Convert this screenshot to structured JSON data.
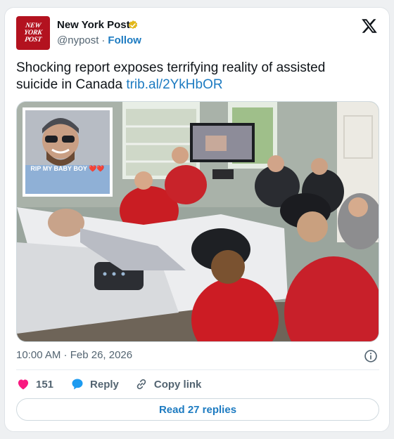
{
  "account": {
    "logo_lines": [
      "NEW",
      "YORK",
      "POST"
    ],
    "name": "New York Post",
    "handle": "@nypost",
    "separator": "·",
    "follow_label": "Follow"
  },
  "tweet": {
    "text": "Shocking report exposes terrifying reality of assisted suicide in Canada ",
    "link": "trib.al/2YkHbOR",
    "image_inset_caption": "RIP MY BABY BOY ❤️❤️"
  },
  "meta": {
    "timestamp": "10:00 AM · Feb 26, 2026"
  },
  "actions": {
    "likes": "151",
    "reply_label": "Reply",
    "copy_link_label": "Copy link"
  },
  "footer": {
    "read_replies_label": "Read 27 replies"
  },
  "colors": {
    "brand_red": "#b3121f",
    "link_blue": "#1d7bc1",
    "like_pink": "#f91880",
    "reply_blue": "#1d9bf0",
    "verified_gold": "#e2b719"
  },
  "icons": [
    "verified-badge-icon",
    "x-logo-icon",
    "info-icon",
    "heart-icon",
    "reply-bubble-icon",
    "copy-link-icon"
  ]
}
